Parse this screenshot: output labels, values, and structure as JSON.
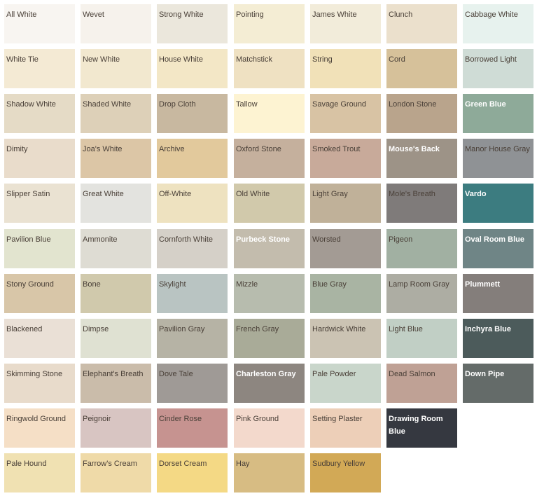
{
  "swatches": [
    [
      {
        "name": "All White",
        "color": "#f8f5f1",
        "text": "dark"
      },
      {
        "name": "Wevet",
        "color": "#f6f2ec",
        "text": "dark"
      },
      {
        "name": "Strong White",
        "color": "#ebe7dc",
        "text": "dark"
      },
      {
        "name": "Pointing",
        "color": "#f4edd4",
        "text": "dark"
      },
      {
        "name": "James White",
        "color": "#f2ecda",
        "text": "dark"
      },
      {
        "name": "Clunch",
        "color": "#ebe0cc",
        "text": "dark"
      },
      {
        "name": "Cabbage White",
        "color": "#e7f2ee",
        "text": "dark"
      }
    ],
    [
      {
        "name": "White Tie",
        "color": "#f4ead4",
        "text": "dark"
      },
      {
        "name": "New White",
        "color": "#f2e8cf",
        "text": "dark"
      },
      {
        "name": "House White",
        "color": "#f3e7c6",
        "text": "dark"
      },
      {
        "name": "Matchstick",
        "color": "#efe1c2",
        "text": "dark"
      },
      {
        "name": "String",
        "color": "#f1e1b8",
        "text": "dark"
      },
      {
        "name": "Cord",
        "color": "#d6c19a",
        "text": "dark"
      },
      {
        "name": "Borrowed Light",
        "color": "#cfdcd6",
        "text": "dark"
      }
    ],
    [
      {
        "name": "Shadow White",
        "color": "#e5dbc6",
        "text": "dark"
      },
      {
        "name": "Shaded White",
        "color": "#ddd0b8",
        "text": "dark"
      },
      {
        "name": "Drop Cloth",
        "color": "#c8b8a0",
        "text": "dark"
      },
      {
        "name": "Tallow",
        "color": "#fdf3d2",
        "text": "dark"
      },
      {
        "name": "Savage Ground",
        "color": "#d8c3a4",
        "text": "dark"
      },
      {
        "name": "London Stone",
        "color": "#b9a48c",
        "text": "dark"
      },
      {
        "name": "Green Blue",
        "color": "#8eaa99",
        "text": "light"
      }
    ],
    [
      {
        "name": "Dimity",
        "color": "#e9dccb",
        "text": "dark"
      },
      {
        "name": "Joa's White",
        "color": "#dcc6a6",
        "text": "dark"
      },
      {
        "name": "Archive",
        "color": "#e2c99c",
        "text": "dark"
      },
      {
        "name": "Oxford Stone",
        "color": "#c5b09d",
        "text": "dark"
      },
      {
        "name": "Smoked Trout",
        "color": "#c8aa9a",
        "text": "dark"
      },
      {
        "name": "Mouse's Back",
        "color": "#9d9387",
        "text": "light"
      },
      {
        "name": "Manor House Gray",
        "color": "#8f9295",
        "text": "dark"
      }
    ],
    [
      {
        "name": "Slipper Satin",
        "color": "#eae2d2",
        "text": "dark"
      },
      {
        "name": "Great White",
        "color": "#e3e3df",
        "text": "dark"
      },
      {
        "name": "Off-White",
        "color": "#eee2c0",
        "text": "dark"
      },
      {
        "name": "Old White",
        "color": "#d1c9ab",
        "text": "dark"
      },
      {
        "name": "Light Gray",
        "color": "#c0b199",
        "text": "dark"
      },
      {
        "name": "Mole's Breath",
        "color": "#7f7b7a",
        "text": "dark"
      },
      {
        "name": "Vardo",
        "color": "#3c7c80",
        "text": "light"
      }
    ],
    [
      {
        "name": "Pavilion Blue",
        "color": "#e2e4cf",
        "text": "dark"
      },
      {
        "name": "Ammonite",
        "color": "#dedcd3",
        "text": "dark"
      },
      {
        "name": "Cornforth White",
        "color": "#d5d0c8",
        "text": "dark"
      },
      {
        "name": "Purbeck Stone",
        "color": "#c3bcad",
        "text": "light"
      },
      {
        "name": "Worsted",
        "color": "#a39b94",
        "text": "dark"
      },
      {
        "name": "Pigeon",
        "color": "#a1b0a2",
        "text": "dark"
      },
      {
        "name": "Oval Room Blue",
        "color": "#6f8586",
        "text": "light"
      }
    ],
    [
      {
        "name": "Stony Ground",
        "color": "#d8c6a8",
        "text": "dark"
      },
      {
        "name": "Bone",
        "color": "#d0c9ac",
        "text": "dark"
      },
      {
        "name": "Skylight",
        "color": "#b9c4c2",
        "text": "dark"
      },
      {
        "name": "Mizzle",
        "color": "#b7bcae",
        "text": "dark"
      },
      {
        "name": "Blue Gray",
        "color": "#a9b4a3",
        "text": "dark"
      },
      {
        "name": "Lamp Room Gray",
        "color": "#adada3",
        "text": "dark"
      },
      {
        "name": "Plummett",
        "color": "#847e7b",
        "text": "light"
      }
    ],
    [
      {
        "name": "Blackened",
        "color": "#eae0d6",
        "text": "dark"
      },
      {
        "name": "Dimpse",
        "color": "#dfe1d2",
        "text": "dark"
      },
      {
        "name": "Pavilion Gray",
        "color": "#b6b3a5",
        "text": "dark"
      },
      {
        "name": "French Gray",
        "color": "#a9ab98",
        "text": "dark"
      },
      {
        "name": "Hardwick White",
        "color": "#cbc3b3",
        "text": "dark"
      },
      {
        "name": "Light Blue",
        "color": "#c1cfc5",
        "text": "dark"
      },
      {
        "name": "Inchyra Blue",
        "color": "#4c5b5b",
        "text": "light"
      }
    ],
    [
      {
        "name": "Skimming Stone",
        "color": "#e8dbcb",
        "text": "dark"
      },
      {
        "name": "Elephant's Breath",
        "color": "#cabcaa",
        "text": "dark"
      },
      {
        "name": "Dove Tale",
        "color": "#9f9a96",
        "text": "dark"
      },
      {
        "name": "Charleston Gray",
        "color": "#8d8680",
        "text": "light"
      },
      {
        "name": "Pale Powder",
        "color": "#c9d6cb",
        "text": "dark"
      },
      {
        "name": "Dead Salmon",
        "color": "#bfa195",
        "text": "dark"
      },
      {
        "name": "Down Pipe",
        "color": "#646b69",
        "text": "light"
      }
    ],
    [
      {
        "name": "Ringwold Ground",
        "color": "#f5dfc6",
        "text": "dark"
      },
      {
        "name": "Peignoir",
        "color": "#d8c5c2",
        "text": "dark"
      },
      {
        "name": "Cinder Rose",
        "color": "#c69390",
        "text": "dark"
      },
      {
        "name": "Pink Ground",
        "color": "#f3d9cc",
        "text": "dark"
      },
      {
        "name": "Setting Plaster",
        "color": "#edcfb8",
        "text": "dark"
      },
      {
        "name": "Drawing Room Blue",
        "color": "#353840",
        "text": "light"
      }
    ],
    [
      {
        "name": "Pale Hound",
        "color": "#f0e1b2",
        "text": "dark"
      },
      {
        "name": "Farrow's Cream",
        "color": "#efdaa8",
        "text": "dark"
      },
      {
        "name": "Dorset Cream",
        "color": "#f4d985",
        "text": "dark"
      },
      {
        "name": "Hay",
        "color": "#d7bc83",
        "text": "dark"
      },
      {
        "name": "Sudbury Yellow",
        "color": "#d2a956",
        "text": "dark"
      }
    ]
  ]
}
